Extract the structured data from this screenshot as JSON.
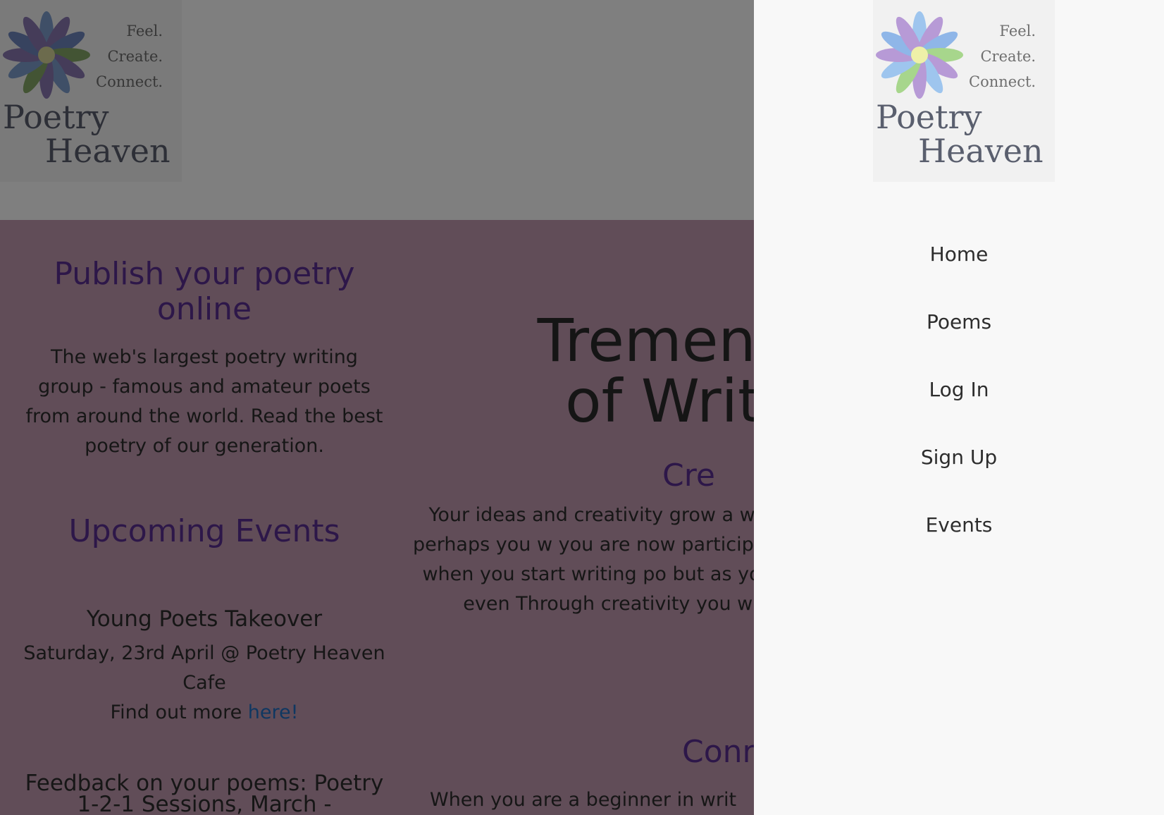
{
  "logo": {
    "tagline": [
      "Feel.",
      "Create.",
      "Connect."
    ],
    "name_line1": "Poetry",
    "name_line2": "Heaven"
  },
  "left_column": {
    "publish_title": "Publish your poetry online",
    "intro": "The web's largest poetry writing group - famous and amateur poets from around the world. Read the best poetry of our generation.",
    "events_title": "Upcoming Events",
    "event1": {
      "title": "Young Poets Takeover",
      "detail": "Saturday, 23rd April @ Poetry Heaven Cafe",
      "more_prefix": "Find out more ",
      "more_link": "here!"
    },
    "event2": {
      "title": "Feedback on your poems: Poetry 1-2-1 Sessions, March -"
    }
  },
  "right_column": {
    "big_title_line1": "Tremendo",
    "big_title_line2": "of Writir",
    "sub1": "Cre",
    "body": "Your ideas and creativity grow a were a teenager perhaps you w you are now participating in poe that when you start writing po but as you keep writing, even Through creativity you will be amazi",
    "sub2": "Conr",
    "body2": "When you are a beginner in writ"
  },
  "drawer": {
    "nav": [
      "Home",
      "Poems",
      "Log In",
      "Sign Up",
      "Events"
    ]
  },
  "colors": {
    "accent_purple": "#5b2e93",
    "link_blue": "#1f6fc2",
    "main_bg": "#c29ab0",
    "drawer_bg": "#f8f8f8"
  }
}
